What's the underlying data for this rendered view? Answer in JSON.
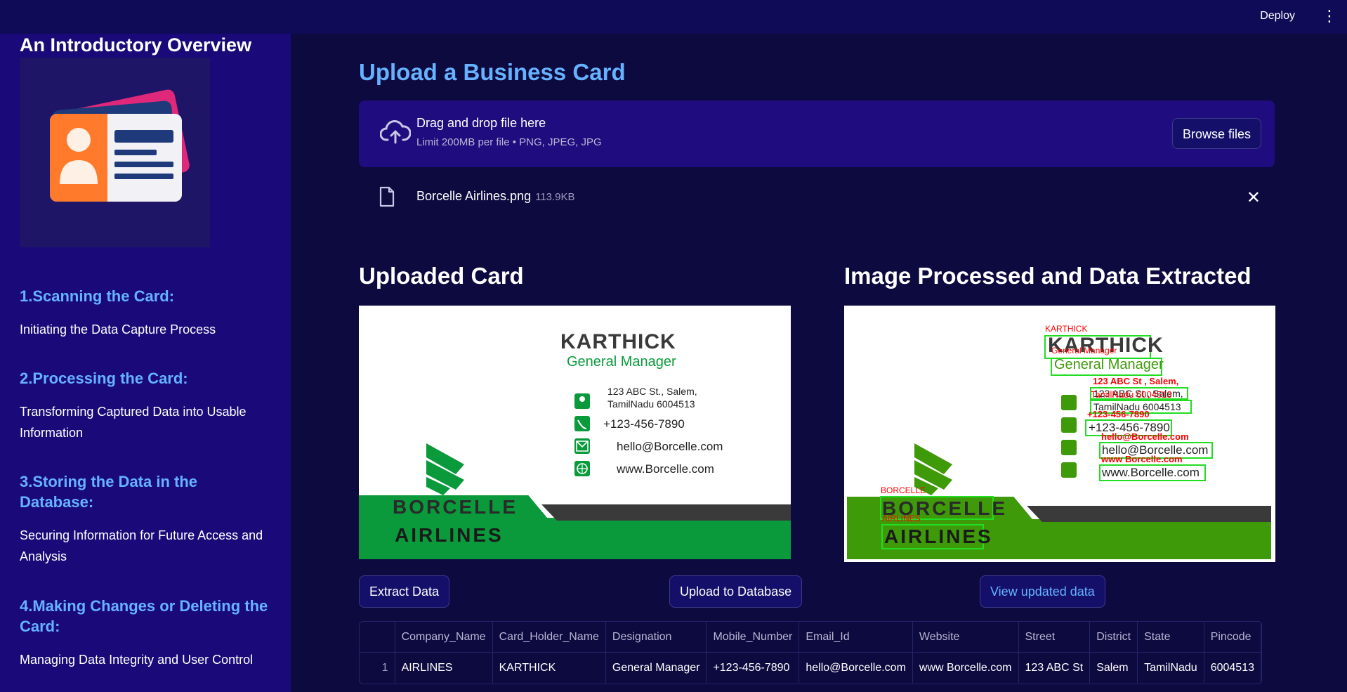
{
  "header": {
    "deploy_label": "Deploy",
    "menu_icon": "kebab-menu-icon"
  },
  "sidebar": {
    "title": "An Introductory Overview",
    "logo_icon": "business-card-icon",
    "sections": [
      {
        "heading": "1.Scanning the Card:",
        "text": "Initiating the Data Capture Process"
      },
      {
        "heading": "2.Processing the Card:",
        "text": "Transforming Captured Data into Usable Information"
      },
      {
        "heading": "3.Storing the Data in the Database:",
        "text": "Securing Information for Future Access and Analysis"
      },
      {
        "heading": "4.Making Changes or Deleting the Card:",
        "text": "Managing Data Integrity and User Control"
      }
    ]
  },
  "upload": {
    "title": "Upload a Business Card",
    "drag_text": "Drag and drop file here",
    "limit_text": "Limit 200MB per file • PNG, JPEG, JPG",
    "browse_label": "Browse files",
    "file_name": "Borcelle Airlines.png",
    "file_size": "113.9KB"
  },
  "uploaded_card": {
    "title": "Uploaded Card",
    "name": "KARTHICK",
    "designation": "General Manager",
    "address_line1": "123 ABC St., Salem,",
    "address_line2": "TamilNadu 6004513",
    "phone": "+123-456-7890",
    "email": "hello@Borcelle.com",
    "website": "www.Borcelle.com",
    "company_line1": "BORCELLE",
    "company_line2": "AIRLINES"
  },
  "processed_card": {
    "title": "Image Processed and Data Extracted",
    "name": "KARTHICK",
    "designation": "General Manager",
    "address_line1": "123 ABC St , Salem,",
    "address_line2": "TamilNadu 6004513",
    "phone": "+123-456-7890",
    "email": "hello@Borcelle.com",
    "website": "www.Borcelle.com",
    "company_line1": "BORCELLE",
    "company_line2": "AIRLINES",
    "ocr_name": "KARTHICK",
    "ocr_designation": "General Manager",
    "ocr_address1": "123 ABC St , Salem,",
    "ocr_address2": "TamilNadu 6004513",
    "ocr_phone": "+123-456-7890",
    "ocr_email": "hello@Borcelle.com",
    "ocr_website": "www Borcelle.com",
    "ocr_company1": "BORCELLE",
    "ocr_company2": "AIRLINES"
  },
  "actions": {
    "extract_label": "Extract Data",
    "upload_db_label": "Upload to Database",
    "view_label": "View updated data"
  },
  "table": {
    "columns": [
      "Company_Name",
      "Card_Holder_Name",
      "Designation",
      "Mobile_Number",
      "Email_Id",
      "Website",
      "Street",
      "District",
      "State",
      "Pincode"
    ],
    "rows": [
      {
        "index": "1",
        "cells": [
          "AIRLINES",
          "KARTHICK",
          "General Manager",
          "+123-456-7890",
          "hello@Borcelle.com",
          "www Borcelle.com",
          "123 ABC St",
          "Salem",
          "TamilNadu",
          "6004513"
        ]
      }
    ]
  },
  "colors": {
    "sidebar_bg": "#1a0a79",
    "main_bg": "#0d0a3f",
    "accent_blue": "#66b2ff",
    "card_green": "#0a9a3c",
    "ocr_box": "#22dd22",
    "ocr_text": "#ff0000"
  }
}
